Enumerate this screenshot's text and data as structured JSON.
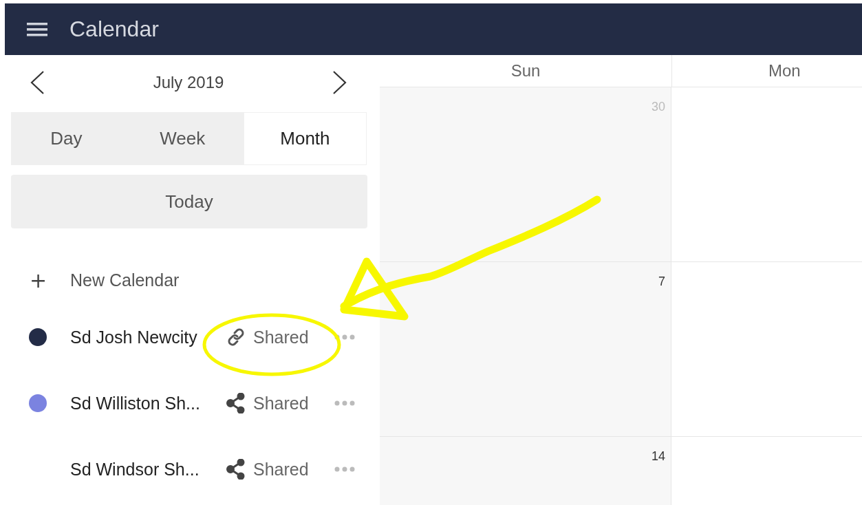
{
  "app_bar": {
    "title": "Calendar"
  },
  "month_nav": {
    "label": "July 2019"
  },
  "view_tabs": [
    {
      "label": "Day",
      "selected": false
    },
    {
      "label": "Week",
      "selected": false
    },
    {
      "label": "Month",
      "selected": true
    }
  ],
  "today_button": "Today",
  "new_calendar": {
    "icon": "+",
    "label": "New Calendar"
  },
  "calendars": [
    {
      "name": "Sd Josh Newcity",
      "color": "#232c47",
      "kind": "link",
      "status": "Shared"
    },
    {
      "name": "Sd Williston Sh...",
      "color": "#7b83e0",
      "kind": "share",
      "status": "Shared"
    },
    {
      "name": "Sd Windsor Sh...",
      "kind": "share",
      "status": "Shared"
    }
  ],
  "grid": {
    "columns": [
      "Sun",
      "Mon"
    ],
    "weeks": [
      {
        "days": [
          {
            "label": "30",
            "other_month": true
          }
        ]
      },
      {
        "days": [
          {
            "label": "7",
            "other_month": false
          }
        ]
      },
      {
        "days": [
          {
            "label": "14",
            "other_month": false
          }
        ]
      }
    ]
  }
}
